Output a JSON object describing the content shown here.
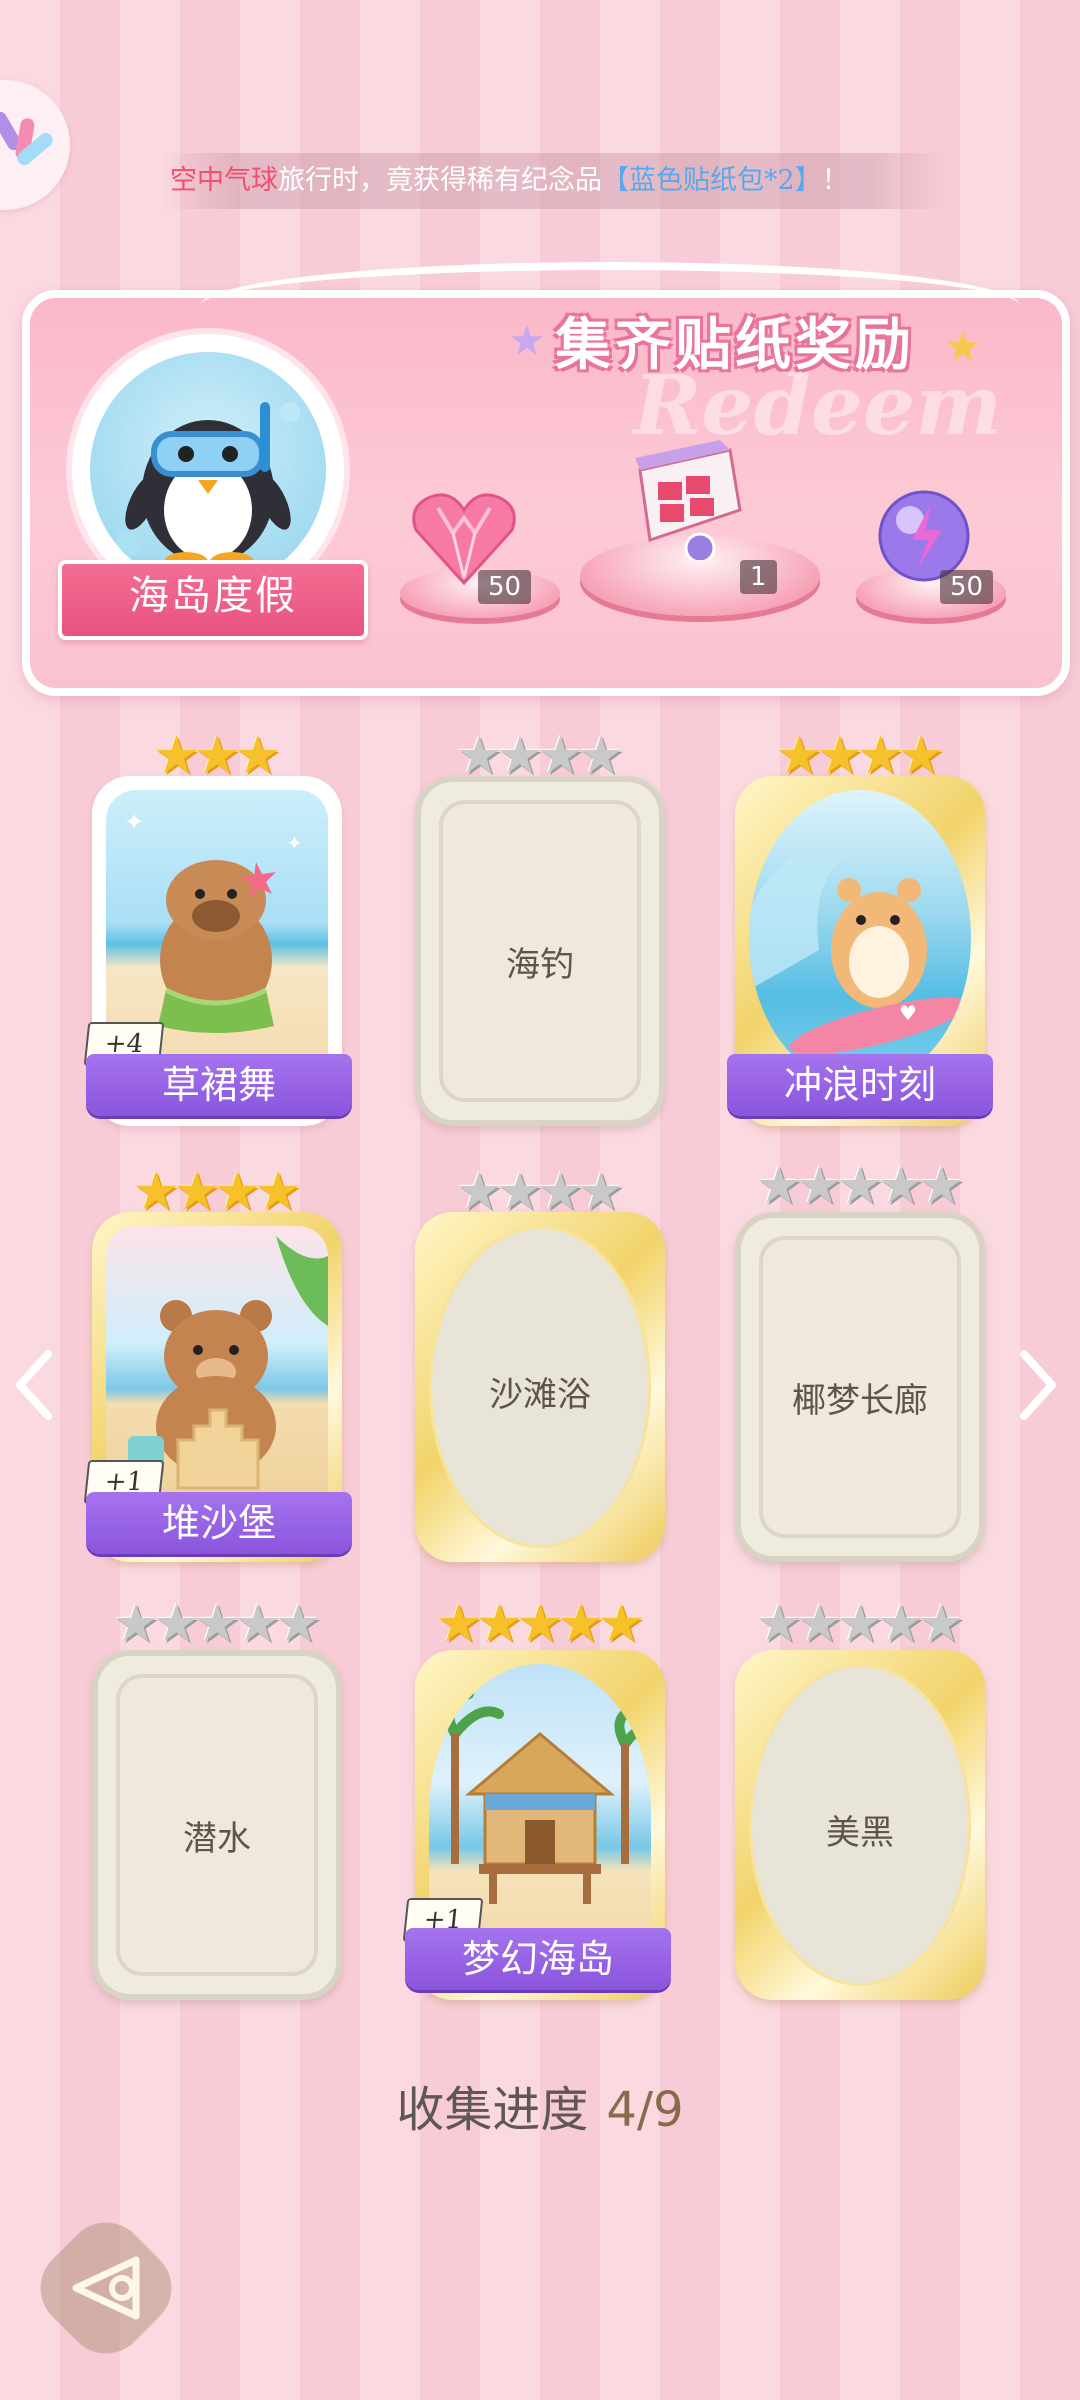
{
  "marquee": {
    "part1": "空中气球",
    "part2": "旅行时，竟获得稀有纪念品",
    "part3": "【蓝色贴纸包*2】",
    "part4": "！"
  },
  "banner": {
    "title": "集齐贴纸奖励",
    "watermark": "Redeem",
    "theme": "海岛度假",
    "rewards": [
      {
        "icon": "pink-heart-gem-icon",
        "count": "50"
      },
      {
        "icon": "gift-box-icon",
        "count": "1"
      },
      {
        "icon": "purple-energy-orb-icon",
        "count": "50"
      }
    ]
  },
  "cards": [
    {
      "name": "草裙舞",
      "stars": 3,
      "collected": true,
      "plus": "+4"
    },
    {
      "name": "海钓",
      "stars": 4,
      "collected": false
    },
    {
      "name": "冲浪时刻",
      "stars": 4,
      "collected": true
    },
    {
      "name": "堆沙堡",
      "stars": 4,
      "collected": true,
      "plus": "+1"
    },
    {
      "name": "沙滩浴",
      "stars": 4,
      "collected": false
    },
    {
      "name": "椰梦长廊",
      "stars": 5,
      "collected": false
    },
    {
      "name": "潜水",
      "stars": 5,
      "collected": false
    },
    {
      "name": "梦幻海岛",
      "stars": 5,
      "collected": true,
      "plus": "+1"
    },
    {
      "name": "美黑",
      "stars": 5,
      "collected": false
    }
  ],
  "progress": {
    "label": "收集进度",
    "value": "4/9"
  },
  "colors": {
    "accent_pink": "#f36d93",
    "ribbon_purple": "#8a55dc",
    "gold_star": "#f7c12b"
  }
}
